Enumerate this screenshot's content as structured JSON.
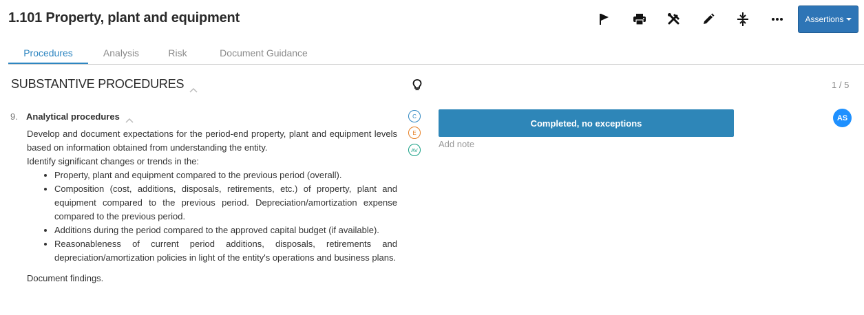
{
  "header": {
    "title": "1.101 Property, plant and equipment",
    "toolbar_icons": [
      "flag-icon",
      "print-icon",
      "tools-icon",
      "pencil-icon",
      "collapse-icon",
      "more-icon"
    ],
    "assertions_label": "Assertions"
  },
  "tabs": [
    {
      "label": "Procedures",
      "active": true
    },
    {
      "label": "Analysis",
      "active": false
    },
    {
      "label": "Risk",
      "active": false
    },
    {
      "label": "Document Guidance",
      "active": false
    }
  ],
  "section": {
    "title": "SUBSTANTIVE PROCEDURES",
    "counter": "1 / 5"
  },
  "procedure": {
    "number": "9.",
    "title": "Analytical procedures",
    "intro": "Develop and document expectations for the period-end property, plant and equipment levels based on information obtained from understanding the entity.",
    "lead": "Identify significant changes or trends in the:",
    "bullets": [
      "Property, plant and equipment compared to the previous period (overall).",
      "Composition (cost, additions, disposals, retirements, etc.) of property, plant and equipment compared to the previous period. Depreciation/amortization expense compared to the previous period.",
      "Additions during the period compared to the approved capital budget (if available).",
      "Reasonableness of current period additions, disposals, retirements and depreciation/amortization policies in light of the entity's operations and business plans."
    ],
    "closing": "Document findings.",
    "assertion_badges": [
      "C",
      "E",
      "AV"
    ],
    "status_label": "Completed, no exceptions",
    "add_note_label": "Add note",
    "assignee_initials": "AS"
  },
  "colors": {
    "accent": "#2e86c1",
    "status_button": "#2e86b8",
    "assertions_button": "#2e75b6",
    "avatar": "#1e90ff",
    "badge_c": "#2e86c1",
    "badge_e": "#e67e22",
    "badge_av": "#16a085"
  }
}
